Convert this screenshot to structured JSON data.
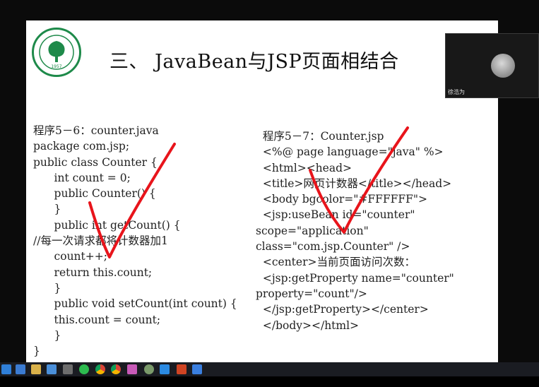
{
  "slide": {
    "title": "三、 JavaBean与JSP页面相结合",
    "logo_caption": "1957"
  },
  "code_left": [
    "程序5－6：counter.java",
    "package com.jsp;",
    "public class Counter {",
    "      int count = 0;",
    "      public Counter() {",
    "      }",
    "      public int getCount() {",
    "//每一次请求都将计数器加1",
    "      count++;",
    "      return this.count;",
    "      }",
    "      public void setCount(int count) {",
    "      this.count = count;",
    "      }",
    "}"
  ],
  "code_right": [
    "  程序5－7：Counter.jsp",
    "  <%@ page language=\"java\" %>",
    "  <html><head>",
    "  <title>网页计数器</title></head>",
    "  <body bgcolor=\"#FFFFFF\">",
    "  <jsp:useBean id=\"counter\"",
    "scope=\"application\"",
    "class=\"com.jsp.Counter\" />",
    "  <center>当前页面访问次数：",
    "  <jsp:getProperty name=\"counter\"",
    "property=\"count\"/>",
    "  </jsp:getProperty></center>",
    "  </body></html>"
  ],
  "video": {
    "participant_name": "徐浩为"
  },
  "colors": {
    "slide_bg": "#FFFFFF",
    "checkmark": "#E8141B",
    "logo_green": "#1E8A4A",
    "desktop_bg": "#0B0B0B",
    "taskbar_bg": "#1A1C22"
  },
  "taskbar": {
    "icons": [
      "start-icon",
      "mail-icon",
      "folder-icon",
      "image-icon",
      "media-icon",
      "wechat-icon",
      "chrome-icon",
      "chrome-icon-2",
      "paint-icon",
      "app-icon",
      "meeting-icon",
      "powerpoint-icon",
      "app-icon-2"
    ]
  }
}
